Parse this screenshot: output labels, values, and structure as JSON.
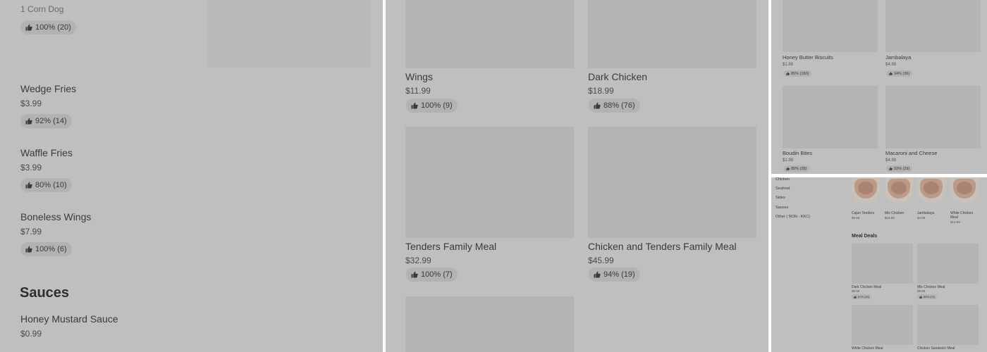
{
  "panel_a": {
    "top_item": {
      "subtext": "1 Corn Dog",
      "rating": "100% (20)"
    },
    "items": [
      {
        "name": "Wedge Fries",
        "price": "$3.99",
        "rating": "92% (14)"
      },
      {
        "name": "Waffle Fries",
        "price": "$3.99",
        "rating": "80% (10)"
      },
      {
        "name": "Boneless Wings",
        "price": "$7.99",
        "rating": "100% (6)"
      }
    ],
    "sauces_section": {
      "title": "Sauces",
      "items": [
        {
          "name": "Honey Mustard Sauce",
          "price": "$0.99"
        }
      ]
    }
  },
  "panel_b": {
    "items": [
      {
        "name": "Wings",
        "price": "$11.99",
        "rating": "100% (9)"
      },
      {
        "name": "Dark Chicken",
        "price": "$18.99",
        "rating": "88% (76)"
      },
      {
        "name": "Tenders Family Meal",
        "price": "$32.99",
        "rating": "100% (7)"
      },
      {
        "name": "Chicken and Tenders Family Meal",
        "price": "$45.99",
        "rating": "94% (19)"
      }
    ]
  },
  "panel_c": {
    "items": [
      {
        "name": "Honey Butter Biscuits",
        "price": "$1.89",
        "rating": "85% (160)"
      },
      {
        "name": "Jambalaya",
        "price": "$4.99",
        "rating": "94% (36)"
      },
      {
        "name": "Boudin Bites",
        "price": "$1.99",
        "rating": "85% (28)"
      },
      {
        "name": "Macaroni and Cheese",
        "price": "$4.99",
        "rating": "93% (29)"
      }
    ]
  },
  "panel_d": {
    "nav": [
      "Chicken",
      "Seafood",
      "Sides",
      "Sauces",
      "Other ( NON - KKC)"
    ],
    "featured": [
      {
        "name": "Cajun Tenders",
        "price": "$9.99"
      },
      {
        "name": "Mix Chicken",
        "price": "$19.99"
      },
      {
        "name": "Jambalaya",
        "price": "$4.99"
      },
      {
        "name": "White Chicken",
        "name_line2": "Meal",
        "price": "$13.99"
      }
    ],
    "meal_deals": {
      "title": "Meal Deals",
      "items": [
        {
          "name": "Dark Chicken Meal",
          "price": "$9.99",
          "rating": "87% (80)"
        },
        {
          "name": "Mix Chicken Meal",
          "price": "$9.99",
          "rating": "88% (22)"
        },
        {
          "name": "White Chicken Meal"
        },
        {
          "name": "Chicken Sandwich Meal"
        }
      ]
    }
  },
  "icons": {
    "rating": "thumbs-up-icon"
  },
  "colors": {
    "overlay_gray": "#bfbfbf",
    "thumb_gray": "#b4b4b4",
    "pill_gray": "#b2b2b2",
    "text": "#3a3a3a"
  }
}
